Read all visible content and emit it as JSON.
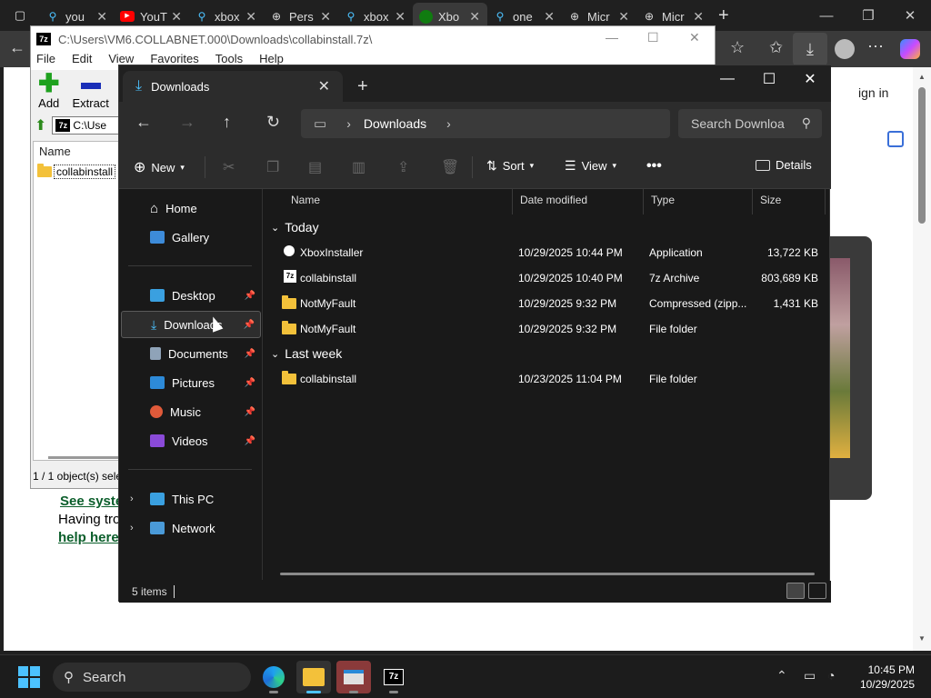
{
  "browser": {
    "tabs": [
      {
        "label": "you",
        "icon": "search-icon",
        "color": "#4cc2ff"
      },
      {
        "label": "YouT",
        "icon": "youtube-icon",
        "color": "#ff0000"
      },
      {
        "label": "xbox",
        "icon": "search-icon",
        "color": "#4cc2ff"
      },
      {
        "label": "Pers",
        "icon": "globe-icon",
        "color": "#ddd"
      },
      {
        "label": "xbox",
        "icon": "search-icon",
        "color": "#4cc2ff"
      },
      {
        "label": "Xbo",
        "icon": "xbox-icon",
        "color": "#107c10"
      },
      {
        "label": "one",
        "icon": "search-icon",
        "color": "#4cc2ff"
      },
      {
        "label": "Micr",
        "icon": "globe-icon",
        "color": "#ddd"
      },
      {
        "label": "Micr",
        "icon": "globe-icon",
        "color": "#ddd"
      }
    ],
    "sign_in_text": "ign in"
  },
  "web": {
    "see_system": "See syste",
    "having_trouble": "Having tro",
    "help_here": "help here."
  },
  "sevenzip": {
    "title": "C:\\Users\\VM6.COLLABNET.000\\Downloads\\collabinstall.7z\\",
    "menu": [
      "File",
      "Edit",
      "View",
      "Favorites",
      "Tools",
      "Help"
    ],
    "tools": {
      "add": "Add",
      "extract": "Extract"
    },
    "address": "C:\\Use",
    "column_name": "Name",
    "item": "collabinstall",
    "status": "1 / 1 object(s) sele"
  },
  "explorer": {
    "tab_title": "Downloads",
    "breadcrumb": "Downloads",
    "search_placeholder": "Search Downloa",
    "commands": {
      "new": "New",
      "sort": "Sort",
      "view": "View",
      "details": "Details"
    },
    "sidebar": {
      "home": "Home",
      "gallery": "Gallery",
      "desktop": "Desktop",
      "downloads": "Downloads",
      "documents": "Documents",
      "pictures": "Pictures",
      "music": "Music",
      "videos": "Videos",
      "this_pc": "This PC",
      "network": "Network"
    },
    "columns": {
      "name": "Name",
      "date": "Date modified",
      "type": "Type",
      "size": "Size"
    },
    "groups": {
      "today": "Today",
      "last_week": "Last week"
    },
    "today_files": [
      {
        "name": "XboxInstaller",
        "date": "10/29/2025 10:44 PM",
        "type": "Application",
        "size": "13,722 KB",
        "icon": "xbox-installer-icon"
      },
      {
        "name": "collabinstall",
        "date": "10/29/2025 10:40 PM",
        "type": "7z Archive",
        "size": "803,689 KB",
        "icon": "7z-archive-icon"
      },
      {
        "name": "NotMyFault",
        "date": "10/29/2025 9:32 PM",
        "type": "Compressed (zipp...",
        "size": "1,431 KB",
        "icon": "zip-folder-icon"
      },
      {
        "name": "NotMyFault",
        "date": "10/29/2025 9:32 PM",
        "type": "File folder",
        "size": "",
        "icon": "folder-icon"
      }
    ],
    "last_week_files": [
      {
        "name": "collabinstall",
        "date": "10/23/2025 11:04 PM",
        "type": "File folder",
        "size": "",
        "icon": "folder-icon"
      }
    ],
    "status": "5 items"
  },
  "taskbar": {
    "search": "Search",
    "time": "10:45 PM",
    "date": "10/29/2025"
  },
  "colors": {
    "accent": "#4cc2ff",
    "folder": "#f3c13a"
  }
}
